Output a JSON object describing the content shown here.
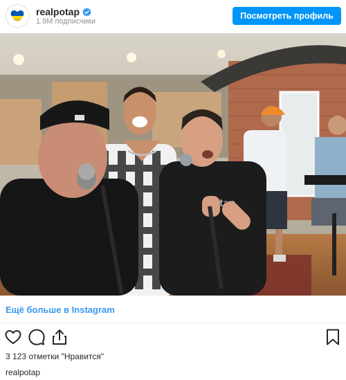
{
  "header": {
    "username": "realpotap",
    "followers": "1.9M подписчики",
    "view_profile_label": "Посмотреть профиль",
    "verified_icon": "verified-badge-icon",
    "avatar_colors": {
      "top": "#0057b7",
      "bottom": "#ffd700"
    }
  },
  "post": {
    "image_alt": "Four men singing into microphones in a recording studio"
  },
  "more_link": "Ещё больше в Instagram",
  "actions": {
    "icons": [
      "heart-icon",
      "comment-icon",
      "share-icon",
      "bookmark-icon"
    ]
  },
  "likes_text": "3 123 отметки \"Нравится\"",
  "caption_username": "realpotap",
  "colors": {
    "accent": "#0095f6",
    "link": "#3897f0",
    "text": "#262626",
    "secondary_text": "#8e8e8e"
  }
}
